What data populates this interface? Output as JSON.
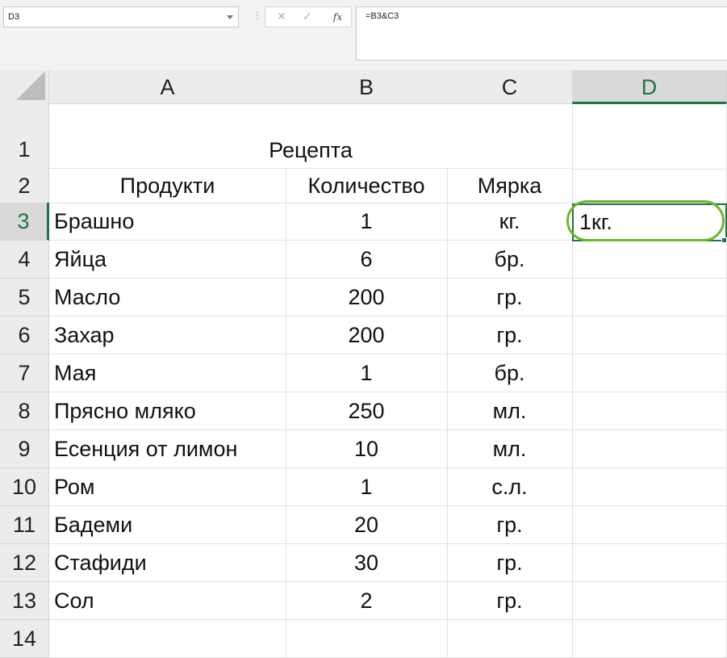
{
  "name_box": {
    "value": "D3"
  },
  "formula_bar": {
    "cancel_glyph": "✕",
    "enter_glyph": "✓",
    "fx_label": "fx",
    "formula": "=B3&C3"
  },
  "columns": [
    "A",
    "B",
    "C",
    "D"
  ],
  "selected_column": "D",
  "selected_row": "3",
  "sheet": {
    "title": "Рецепта",
    "headers": [
      "Продукти",
      "Количество",
      "Мярка"
    ],
    "rows": [
      {
        "row": "3",
        "product": "Брашно",
        "qty": "1",
        "unit": "кг.",
        "result": "1кг."
      },
      {
        "row": "4",
        "product": "Яйца",
        "qty": "6",
        "unit": "бр.",
        "result": ""
      },
      {
        "row": "5",
        "product": "Масло",
        "qty": "200",
        "unit": "гр.",
        "result": ""
      },
      {
        "row": "6",
        "product": "Захар",
        "qty": "200",
        "unit": "гр.",
        "result": ""
      },
      {
        "row": "7",
        "product": "Мая",
        "qty": "1",
        "unit": "бр.",
        "result": ""
      },
      {
        "row": "8",
        "product": "Прясно мляко",
        "qty": "250",
        "unit": "мл.",
        "result": ""
      },
      {
        "row": "9",
        "product": "Есенция от лимон",
        "qty": "10",
        "unit": "мл.",
        "result": ""
      },
      {
        "row": "10",
        "product": "Ром",
        "qty": "1",
        "unit": "с.л.",
        "result": ""
      },
      {
        "row": "11",
        "product": "Бадеми",
        "qty": "20",
        "unit": "гр.",
        "result": ""
      },
      {
        "row": "12",
        "product": "Стафиди",
        "qty": "30",
        "unit": "гр.",
        "result": ""
      },
      {
        "row": "13",
        "product": "Сол",
        "qty": "2",
        "unit": "гр.",
        "result": ""
      }
    ]
  },
  "colors": {
    "accent": "#217346",
    "highlight": "#6eb52e"
  }
}
